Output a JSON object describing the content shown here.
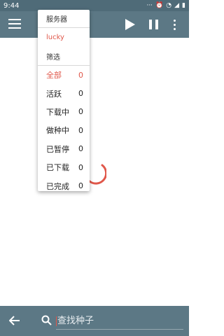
{
  "status_bar": {
    "time": "9:44",
    "icons": [
      "dots-icon",
      "alarm-icon",
      "wifi-icon",
      "signal-icon",
      "battery-icon"
    ]
  },
  "app_bar": {
    "icons": [
      "menu-icon",
      "play-icon",
      "pause-icon",
      "more-icon"
    ],
    "color": "#5c7885"
  },
  "dropdown": {
    "header": "服务器",
    "server": "lucky",
    "filter_header": "筛选",
    "items": [
      {
        "label": "全部",
        "count": "0",
        "active": true
      },
      {
        "label": "活跃",
        "count": "0"
      },
      {
        "label": "下载中",
        "count": "0"
      },
      {
        "label": "做种中",
        "count": "0"
      },
      {
        "label": "已暂停",
        "count": "0"
      },
      {
        "label": "已下载",
        "count": "0"
      },
      {
        "label": "已完成",
        "count": "0"
      }
    ]
  },
  "bottom_bar": {
    "search_placeholder": "查找种子"
  },
  "colors": {
    "accent": "#e0574a",
    "toolbar": "#5c7885",
    "status_bar": "#4f6b78"
  }
}
